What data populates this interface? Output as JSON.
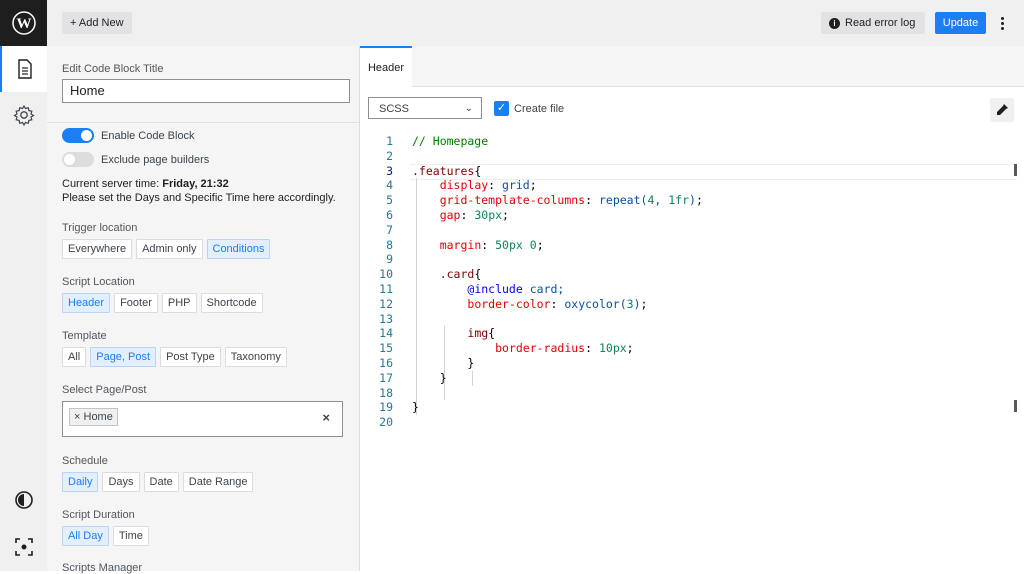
{
  "topbar": {
    "add_new": "+ Add New",
    "read_error_log": "Read error log",
    "update": "Update"
  },
  "rail": {
    "icons": [
      "wordpress-logo-icon",
      "document-icon",
      "gear-icon",
      "contrast-icon",
      "focus-icon"
    ]
  },
  "panel": {
    "title_label": "Edit Code Block Title",
    "title_value": "Home",
    "enable_label": "Enable Code Block",
    "exclude_label": "Exclude page builders",
    "server_time_prefix": "Current server time: ",
    "server_time_value": "Friday, 21:32",
    "server_note": "Please set the Days and Specific Time here accordingly.",
    "trigger": {
      "label": "Trigger location",
      "options": [
        "Everywhere",
        "Admin only",
        "Conditions"
      ],
      "selected": "Conditions"
    },
    "script_location": {
      "label": "Script Location",
      "options": [
        "Header",
        "Footer",
        "PHP",
        "Shortcode"
      ],
      "selected": "Header"
    },
    "template": {
      "label": "Template",
      "options": [
        "All",
        "Page, Post",
        "Post Type",
        "Taxonomy"
      ],
      "selected": "Page, Post"
    },
    "select_page": {
      "label": "Select Page/Post",
      "tag": "Home",
      "tag_remove": "×",
      "clear": "×"
    },
    "schedule": {
      "label": "Schedule",
      "options": [
        "Daily",
        "Days",
        "Date",
        "Date Range"
      ],
      "selected": "Daily"
    },
    "duration": {
      "label": "Script Duration",
      "options": [
        "All Day",
        "Time"
      ],
      "selected": "All Day"
    },
    "scripts_manager": "Scripts Manager"
  },
  "editor": {
    "tab": "Header",
    "language": "SCSS",
    "create_file_label": "Create file",
    "create_file_checked": true,
    "line_numbers": [
      "1",
      "2",
      "3",
      "4",
      "5",
      "6",
      "7",
      "8",
      "9",
      "10",
      "11",
      "12",
      "13",
      "14",
      "15",
      "16",
      "17",
      "18",
      "19",
      "20"
    ],
    "current_line": 3,
    "lines": [
      "// Homepage",
      "",
      ".features{",
      "    display: grid;",
      "    grid-template-columns: repeat(4, 1fr);",
      "    gap: 30px;",
      "",
      "    margin: 50px 0;",
      "",
      "    .card{",
      "        @include card;",
      "        border-color: oxycolor(3);",
      "",
      "        img{",
      "            border-radius: 10px;",
      "        }",
      "    }",
      "",
      "}",
      ""
    ]
  }
}
